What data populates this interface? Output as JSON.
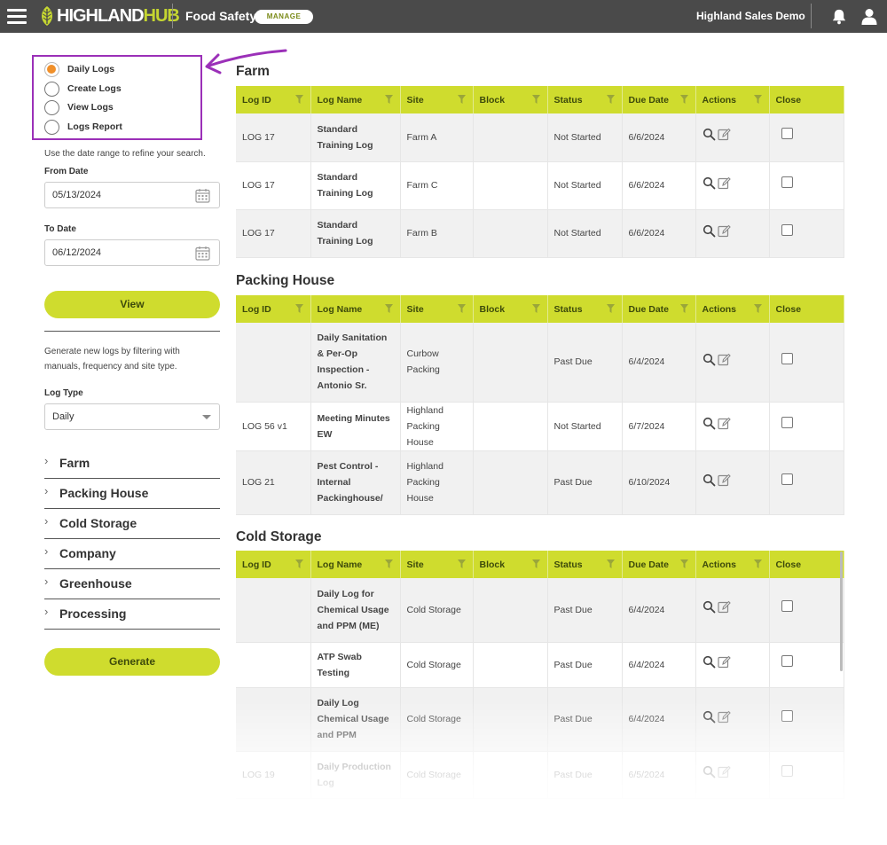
{
  "topbar": {
    "logo_main": "HIGHLAND",
    "logo_accent": "HUB",
    "module": "Food Safety",
    "manage": "MANAGE",
    "account": "Highland Sales Demo"
  },
  "sidebar": {
    "radios": [
      {
        "label": "Daily Logs",
        "checked": true
      },
      {
        "label": "Create Logs",
        "checked": false
      },
      {
        "label": "View Logs",
        "checked": false
      },
      {
        "label": "Logs Report",
        "checked": false
      }
    ],
    "date_hint": "Use the date range to refine your search.",
    "from_label": "From Date",
    "from_value": "05/13/2024",
    "to_label": "To Date",
    "to_value": "06/12/2024",
    "view_button": "View",
    "generate_hint": "Generate new logs by filtering with manuals, frequency and site type.",
    "log_type_label": "Log Type",
    "log_type_value": "Daily",
    "categories": [
      "Farm",
      "Packing House",
      "Cold Storage",
      "Company",
      "Greenhouse",
      "Processing"
    ],
    "generate_button": "Generate"
  },
  "columns": [
    "Log ID",
    "Log Name",
    "Site",
    "Block",
    "Status",
    "Due Date",
    "Actions",
    "Close"
  ],
  "sections": [
    {
      "title": "Farm",
      "rows": [
        {
          "id": "LOG 17",
          "name": "Standard Training Log",
          "site": "Farm A",
          "block": "",
          "status": "Not Started",
          "due": "6/6/2024"
        },
        {
          "id": "LOG 17",
          "name": "Standard Training Log",
          "site": "Farm C",
          "block": "",
          "status": "Not Started",
          "due": "6/6/2024"
        },
        {
          "id": "LOG 17",
          "name": "Standard Training Log",
          "site": "Farm B",
          "block": "",
          "status": "Not Started",
          "due": "6/6/2024"
        }
      ]
    },
    {
      "title": "Packing House",
      "rows": [
        {
          "id": "",
          "name": "Daily Sanitation & Per-Op Inspection - Antonio Sr.",
          "site": "Curbow Packing",
          "block": "",
          "status": "Past Due",
          "due": "6/4/2024"
        },
        {
          "id": "LOG 56 v1",
          "name": "Meeting Minutes EW",
          "site": "Highland Packing House",
          "block": "",
          "status": "Not Started",
          "due": "6/7/2024"
        },
        {
          "id": "LOG 21",
          "name": "Pest Control - Internal Packinghouse/",
          "site": "Highland Packing House",
          "block": "",
          "status": "Past Due",
          "due": "6/10/2024"
        }
      ]
    },
    {
      "title": "Cold Storage",
      "rows": [
        {
          "id": "",
          "name": "Daily Log for Chemical Usage and PPM (ME)",
          "site": "Cold Storage",
          "block": "",
          "status": "Past Due",
          "due": "6/4/2024"
        },
        {
          "id": "",
          "name": "ATP Swab Testing",
          "site": "Cold Storage",
          "block": "",
          "status": "Past Due",
          "due": "6/4/2024"
        },
        {
          "id": "",
          "name": "Daily Log Chemical Usage and PPM",
          "site": "Cold Storage",
          "block": "",
          "status": "Past Due",
          "due": "6/4/2024"
        },
        {
          "id": "LOG 19",
          "name": "Daily Production Log",
          "site": "Cold Storage",
          "block": "",
          "status": "Past Due",
          "due": "6/5/2024"
        }
      ]
    }
  ],
  "colors": {
    "accent": "#cfdc2e",
    "topbar": "#4a4a4a",
    "past_due": "#a21a2e",
    "link": "#7a8a17",
    "highlight_border": "#9b30b8",
    "radio_selected": "#f0902a"
  }
}
